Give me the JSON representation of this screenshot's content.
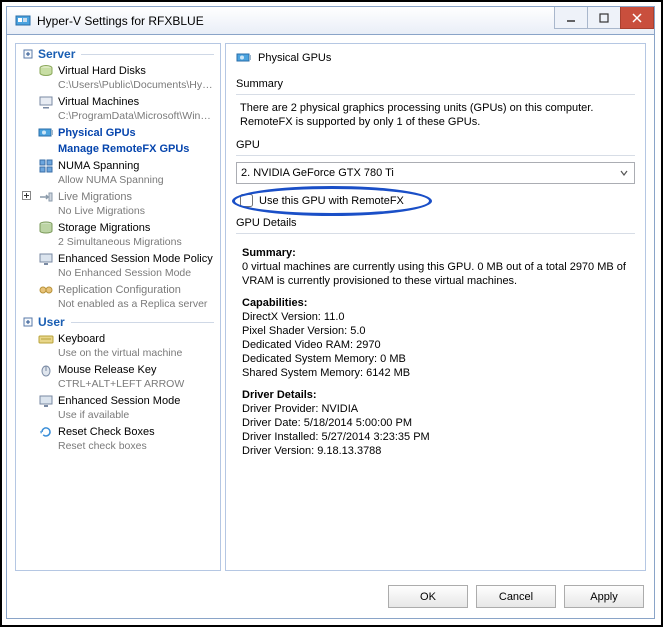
{
  "window": {
    "title": "Hyper-V Settings for RFXBLUE"
  },
  "nav": {
    "cat_server": "Server",
    "cat_user": "User",
    "items": {
      "vhd": {
        "label": "Virtual Hard Disks",
        "sub": "C:\\Users\\Public\\Documents\\Hyper-..."
      },
      "vm": {
        "label": "Virtual Machines",
        "sub": "C:\\ProgramData\\Microsoft\\Windo..."
      },
      "gpu": {
        "label": "Physical GPUs",
        "child": "Manage RemoteFX GPUs"
      },
      "numa": {
        "label": "NUMA Spanning",
        "sub": "Allow NUMA Spanning"
      },
      "live": {
        "label": "Live Migrations",
        "sub": "No Live Migrations"
      },
      "stor": {
        "label": "Storage Migrations",
        "sub": "2 Simultaneous Migrations"
      },
      "esmp": {
        "label": "Enhanced Session Mode Policy",
        "sub": "No Enhanced Session Mode"
      },
      "repl": {
        "label": "Replication Configuration",
        "sub": "Not enabled as a Replica server"
      },
      "kbd": {
        "label": "Keyboard",
        "sub": "Use on the virtual machine"
      },
      "mrk": {
        "label": "Mouse Release Key",
        "sub": "CTRL+ALT+LEFT ARROW"
      },
      "esm": {
        "label": "Enhanced Session Mode",
        "sub": "Use if available"
      },
      "rcb": {
        "label": "Reset Check Boxes",
        "sub": "Reset check boxes"
      }
    }
  },
  "content": {
    "header": "Physical GPUs",
    "summary_label": "Summary",
    "summary_text": "There are 2 physical graphics processing units (GPUs) on this computer. RemoteFX is supported by only 1 of these GPUs.",
    "gpu_label": "GPU",
    "gpu_selected": "2. NVIDIA GeForce GTX 780 Ti",
    "use_gpu_label": "Use this GPU with RemoteFX",
    "details_label": "GPU Details",
    "detail_summary_h": "Summary:",
    "detail_summary": "0 virtual machines are currently using this GPU. 0 MB out of a total 2970 MB of VRAM is currently provisioned to these virtual machines.",
    "cap_h": "Capabilities:",
    "cap_lines": {
      "dx": "DirectX Version: 11.0",
      "ps": "Pixel Shader Version: 5.0",
      "vram": "Dedicated Video RAM: 2970",
      "dsm": "Dedicated System Memory: 0 MB",
      "ssm": "Shared System Memory: 6142 MB"
    },
    "drv_h": "Driver Details:",
    "drv_lines": {
      "prov": "Driver Provider: NVIDIA",
      "date": "Driver Date: 5/18/2014 5:00:00 PM",
      "inst": "Driver Installed: 5/27/2014 3:23:35 PM",
      "ver": "Driver Version: 9.18.13.3788"
    }
  },
  "buttons": {
    "ok": "OK",
    "cancel": "Cancel",
    "apply": "Apply"
  }
}
